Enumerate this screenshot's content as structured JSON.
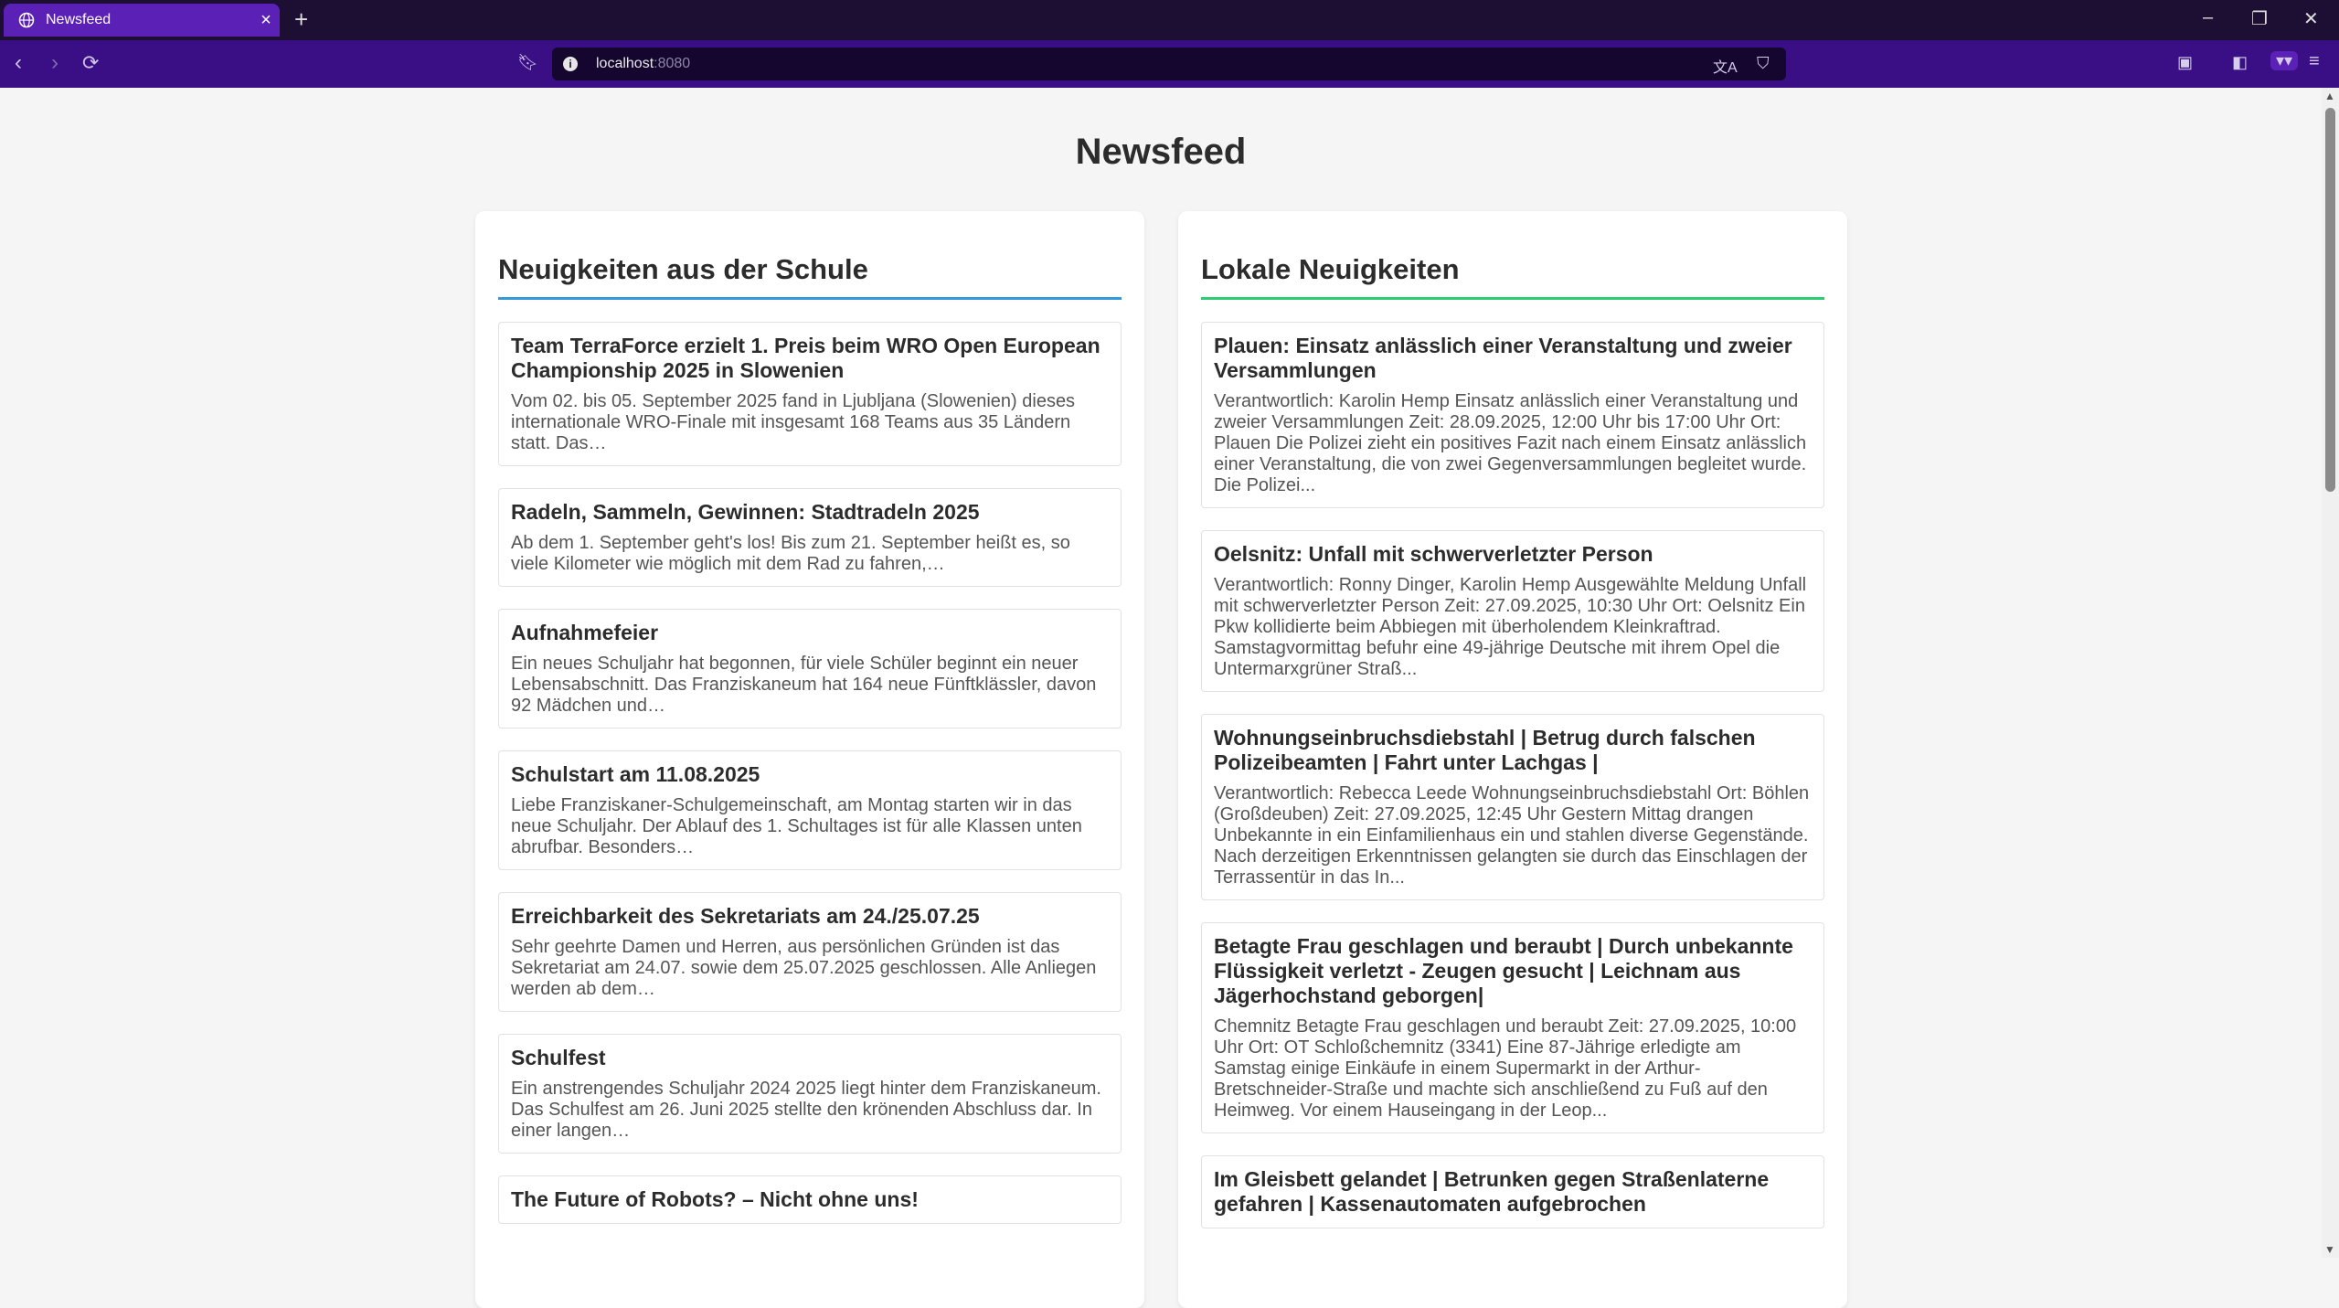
{
  "browser": {
    "tab_title": "Newsfeed",
    "url_host": "localhost",
    "url_port": ":8080"
  },
  "page": {
    "title": "Newsfeed",
    "school": {
      "heading": "Neuigkeiten aus der Schule",
      "items": [
        {
          "title": "Team TerraForce erzielt 1. Preis beim WRO Open European Championship 2025 in Slowenien",
          "text": "Vom 02. bis 05. September 2025 fand in Ljubljana (Slowenien) dieses internationale WRO-Finale mit insgesamt 168 Teams aus 35 Ländern statt. Das…"
        },
        {
          "title": "Radeln, Sammeln, Gewinnen: Stadtradeln 2025",
          "text": "Ab dem 1. September geht's los! Bis zum 21. September heißt es, so viele Kilometer wie möglich mit dem Rad zu fahren,…"
        },
        {
          "title": "Aufnahmefeier",
          "text": "Ein neues Schuljahr hat begonnen, für viele Schüler beginnt ein neuer Lebensabschnitt. Das Franziskaneum hat 164 neue Fünftklässler, davon 92 Mädchen und…"
        },
        {
          "title": "Schulstart am 11.08.2025",
          "text": "Liebe Franziskaner-Schulgemeinschaft, am Montag starten wir in das neue Schuljahr. Der Ablauf des 1. Schultages ist für alle Klassen unten abrufbar. Besonders…"
        },
        {
          "title": "Erreichbarkeit des Sekretariats am 24./25.07.25",
          "text": "Sehr geehrte Damen und Herren, aus persönlichen Gründen ist das Sekretariat am 24.07. sowie dem 25.07.2025 geschlossen. Alle Anliegen werden ab dem…"
        },
        {
          "title": "Schulfest",
          "text": "Ein anstrengendes Schuljahr 2024 2025 liegt hinter dem Franziskaneum. Das Schulfest am 26. Juni 2025 stellte den krönenden Abschluss dar. In einer langen…"
        },
        {
          "title": "The Future of Robots? – Nicht ohne uns!",
          "text": ""
        }
      ]
    },
    "local": {
      "heading": "Lokale Neuigkeiten",
      "items": [
        {
          "title": "Plauen: Einsatz anlässlich einer Veranstaltung und zweier Versammlungen",
          "text": "Verantwortlich: Karolin Hemp Einsatz anlässlich einer Veranstaltung und zweier Versammlungen Zeit: 28.09.2025, 12:00 Uhr bis 17:00 Uhr Ort: Plauen Die Polizei zieht ein positives Fazit nach einem Einsatz anlässlich einer Veranstaltung, die von zwei Gegenversammlungen begleitet wurde. Die Polizei..."
        },
        {
          "title": "Oelsnitz: Unfall mit schwerverletzter Person",
          "text": "Verantwortlich: Ronny Dinger, Karolin Hemp Ausgewählte Meldung Unfall mit schwerverletzter Person Zeit: 27.09.2025, 10:30 Uhr Ort: Oelsnitz Ein Pkw kollidierte beim Abbiegen mit überholendem Kleinkraftrad. Samstagvormittag befuhr eine 49-jährige Deutsche mit ihrem Opel die Untermarxgrüner Straß..."
        },
        {
          "title": "Wohnungseinbruchsdiebstahl | Betrug durch falschen Polizeibeamten | Fahrt unter Lachgas |",
          "text": "Verantwortlich: Rebecca Leede Wohnungseinbruchsdiebstahl Ort: Böhlen (Großdeuben) Zeit: 27.09.2025, 12:45 Uhr Gestern Mittag drangen Unbekannte in ein Einfamilienhaus ein und stahlen diverse Gegenstände. Nach derzeitigen Erkenntnissen gelangten sie durch das Einschlagen der Terrassentür in das In..."
        },
        {
          "title": "Betagte Frau geschlagen und beraubt | Durch unbekannte Flüssigkeit verletzt - Zeugen gesucht | Leichnam aus Jägerhochstand geborgen|",
          "text": "Chemnitz Betagte Frau geschlagen und beraubt Zeit: 27.09.2025, 10:00 Uhr Ort: OT Schloßchemnitz (3341) Eine 87-Jährige erledigte am Samstag einige Einkäufe in einem Supermarkt in der Arthur-Bretschneider-Straße und machte sich anschließend zu Fuß auf den Heimweg. Vor einem Hauseingang in der Leop..."
        },
        {
          "title": "Im Gleisbett gelandet | Betrunken gegen Straßenlaterne gefahren | Kassenautomaten aufgebrochen",
          "text": ""
        }
      ]
    }
  }
}
